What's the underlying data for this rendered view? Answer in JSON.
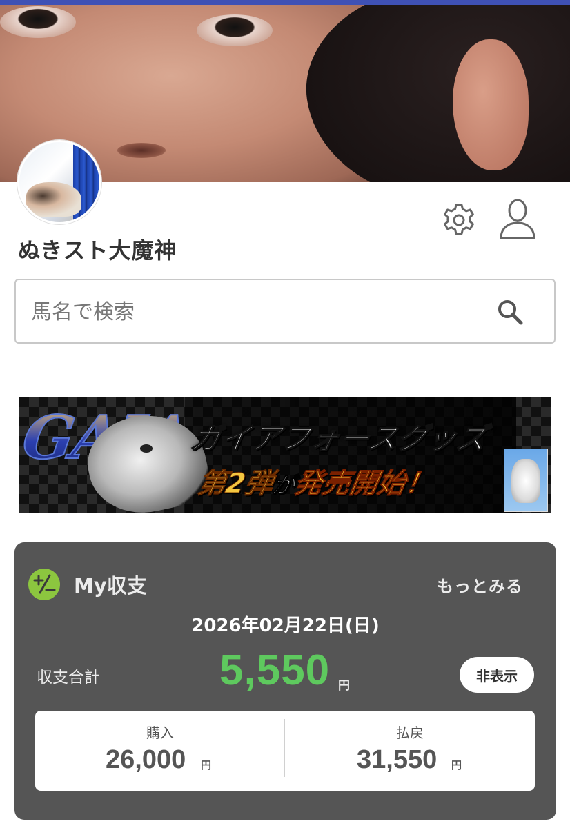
{
  "profile": {
    "username": "ぬきスト大魔神",
    "cover_image": "close-up-face-photo",
    "avatar_image": "person-on-bed-photo"
  },
  "header": {
    "settings_icon": "gear-icon",
    "account_icon": "user-icon"
  },
  "search": {
    "placeholder": "馬名で検索",
    "value": "",
    "icon": "search-icon"
  },
  "banner": {
    "logo_text": "GAIA",
    "title": "ガイアフォースグッズ",
    "sub_part1": "第2弾",
    "sub_part2": "が",
    "sub_part3": "発売開始！"
  },
  "balance": {
    "icon": "plus-minus-icon",
    "title": "My収支",
    "more_label": "もっとみる",
    "date": "2026年02月22日(日)",
    "total_label": "収支合計",
    "total_value": "5,550",
    "unit": "円",
    "hide_label": "非表示",
    "purchase_label": "購入",
    "purchase_value": "26,000",
    "payout_label": "払戻",
    "payout_value": "31,550",
    "accent_color": "#5ec95e",
    "panel_color": "#555555"
  },
  "colors": {
    "top_bar": "#3f51b5"
  }
}
